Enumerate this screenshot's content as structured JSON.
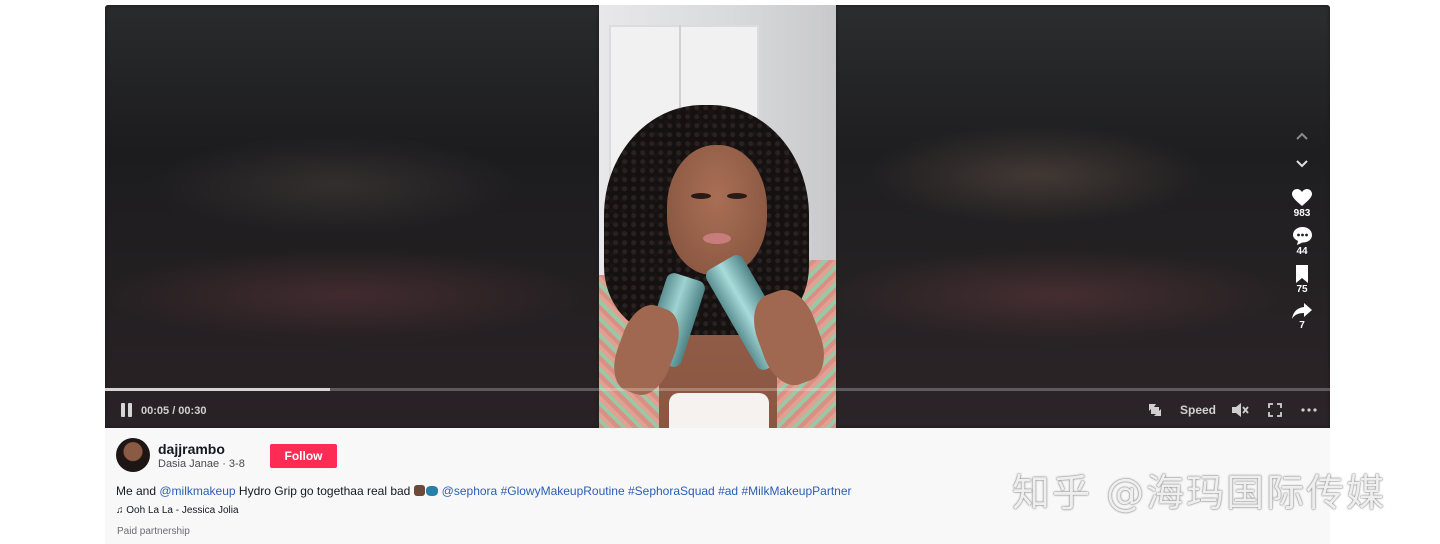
{
  "player": {
    "time": "00:05 / 00:30",
    "progress_fraction": 0.184,
    "speed_label": "Speed"
  },
  "actions": {
    "likes": "983",
    "comments": "44",
    "saves": "75",
    "shares": "7"
  },
  "author": {
    "username": "dajjrambo",
    "subline": "Dasia Janae · 3-8",
    "follow_label": "Follow"
  },
  "caption": {
    "prefix": "Me and ",
    "mention1": "@milkmakeup",
    "middle": " Hydro Grip go togethaa real bad ",
    "mention2": "@sephora",
    "tags": [
      "#GlowyMakeupRoutine",
      "#SephoraSquad",
      "#ad",
      "#MilkMakeupPartner"
    ]
  },
  "music": "♫ Ooh La La - Jessica Jolia",
  "paid_label": "Paid partnership",
  "watermark": "知乎 @海玛国际传媒",
  "icons": {
    "pause": "pause-icon",
    "up": "chevron-up-icon",
    "down": "chevron-down-icon",
    "like": "heart-icon",
    "comment": "comment-icon",
    "save": "bookmark-icon",
    "share": "share-icon",
    "pip": "picture-in-picture-icon",
    "mute": "mute-icon",
    "fullscreen": "fullscreen-icon",
    "more": "more-icon"
  },
  "colors": {
    "follow": "#fe2c55",
    "link": "#2b5db9"
  }
}
